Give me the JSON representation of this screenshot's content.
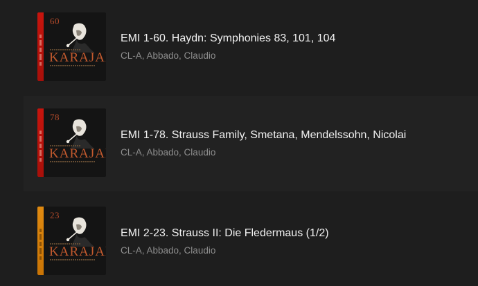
{
  "albums": [
    {
      "volume": "60",
      "brand": "KARAJAN",
      "title": "EMI 1-60. Haydn: Symphonies 83, 101, 104",
      "artists": "CL-A, Abbado, Claudio",
      "spine_color": "#c7140d"
    },
    {
      "volume": "78",
      "brand": "KARAJAN",
      "title": "EMI 1-78. Strauss Family, Smetana, Mendelssohn, Nicolai",
      "artists": "CL-A, Abbado, Claudio",
      "spine_color": "#c7140d"
    },
    {
      "volume": "23",
      "brand": "KARAJAN",
      "title": "EMI 2-23. Strauss II: Die Fledermaus (1/2)",
      "artists": "CL-A, Abbado, Claudio",
      "spine_color": "#e08a10"
    }
  ],
  "colors": {
    "background": "#1e1e1e",
    "row_highlight": "#222222",
    "title_text": "#f2f2f2",
    "subtitle_text": "#8e8e8e",
    "brand_accent": "#c35a2e"
  }
}
